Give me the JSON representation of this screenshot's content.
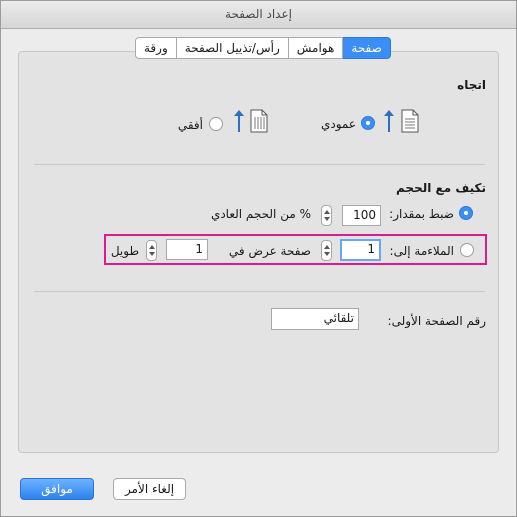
{
  "window": {
    "title": "إعداد الصفحة"
  },
  "tabs": [
    {
      "label": "ورقة"
    },
    {
      "label": "رأس/تذييل الصفحة"
    },
    {
      "label": "هوامش"
    },
    {
      "label": "صفحة"
    }
  ],
  "orientation": {
    "heading": "اتجاه",
    "portrait_label": "عمودي",
    "landscape_label": "أفقي",
    "selected": "portrait"
  },
  "scaling": {
    "heading": "تكيف مع الحجم",
    "adjust_label": "ضبط بمقدار:",
    "adjust_value": "100",
    "adjust_suffix": "% من الحجم العادي",
    "fit_label": "الملاءمة إلى:",
    "fit_wide_value": "1",
    "fit_wide_label": "صفحة عرض في",
    "fit_tall_value": "1",
    "fit_tall_label": "طويل",
    "selected": "adjust"
  },
  "first_page": {
    "label": "رقم الصفحة الأولى:",
    "value": "تلقائي"
  },
  "buttons": {
    "ok": "موافق",
    "cancel": "إلغاء الأمر"
  },
  "colors": {
    "accent": "#3a8ef4",
    "highlight": "#d81b8e"
  }
}
